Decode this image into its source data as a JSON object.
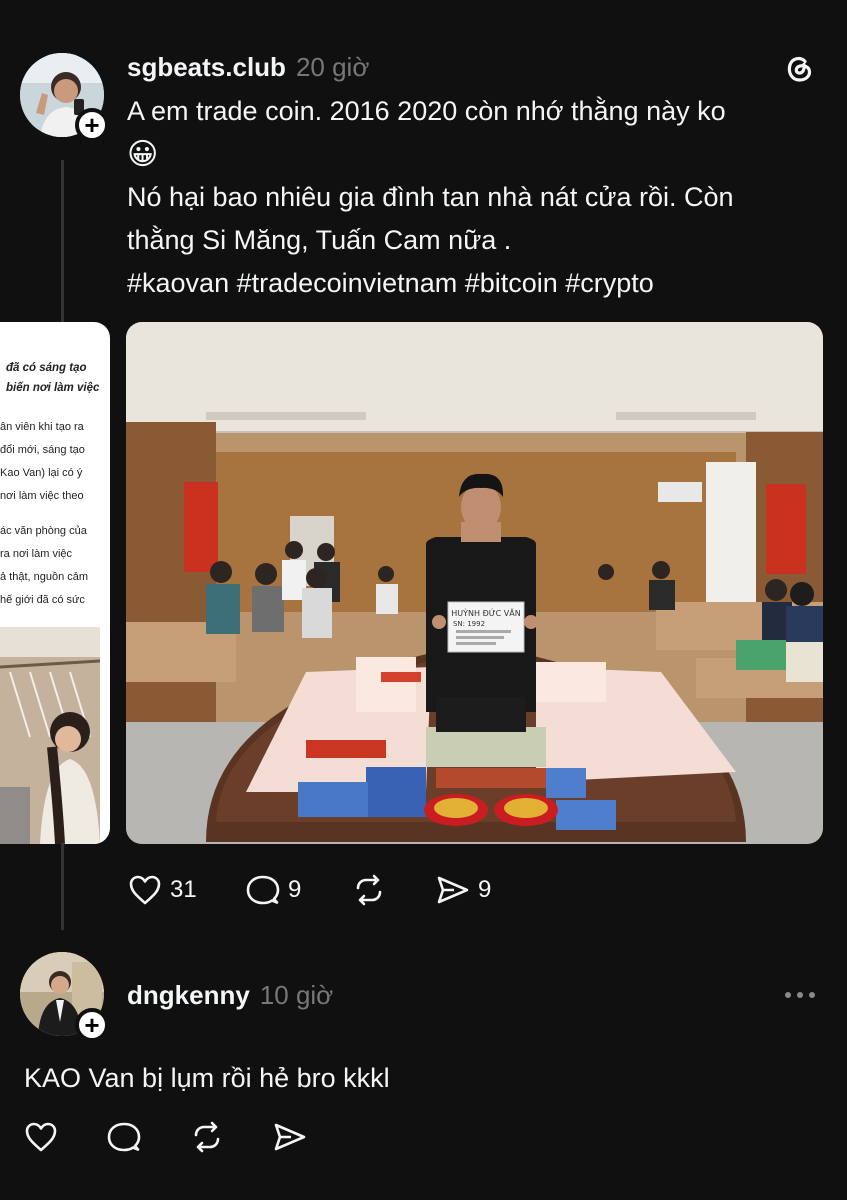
{
  "post": {
    "username": "sgbeats.club",
    "time": "20 giờ",
    "text_line1": "A em trade coin. 2016 2020 còn nhớ thằng này ko",
    "emoji": "😀",
    "text_line3": "Nó hại bao nhiêu gia đình tan nhà nát cửa rồi. Còn",
    "text_line4": "thằng Si Măng, Tuấn Cam nữa .",
    "hashtags": "#kaovan #tradecoinvietnam #bitcoin #crypto",
    "actions": {
      "likes": "31",
      "comments": "9",
      "reposts": "",
      "shares": "9"
    }
  },
  "article_snippet": {
    "heading_line1": "đã có sáng tạo",
    "heading_line2": "biến nơi làm việc",
    "lines": [
      "ân viên khi tạo ra",
      "đổi mới, sáng tạo",
      "Kao Van) lại có ý",
      "nơi làm việc theo",
      "ác văn phòng của",
      "ra nơi làm việc",
      "ả thật, nguồn cảm",
      "hế giới đã có sức"
    ]
  },
  "photo": {
    "sign_line1": "HUỲNH ĐỨC VĂN",
    "sign_line2": "SN: 1992"
  },
  "reply": {
    "username": "dngkenny",
    "time": "10 giờ",
    "text": "KAO Van bị lụm rồi hẻ bro kkkl"
  },
  "icons": {
    "threads": "threads-logo-icon",
    "like": "heart-icon",
    "comment": "comment-icon",
    "repost": "repost-icon",
    "share": "send-icon",
    "more": "more-dots-icon",
    "follow": "plus-icon"
  },
  "colors": {
    "background": "#101010",
    "text": "#f3f5f7",
    "muted": "#777777"
  }
}
